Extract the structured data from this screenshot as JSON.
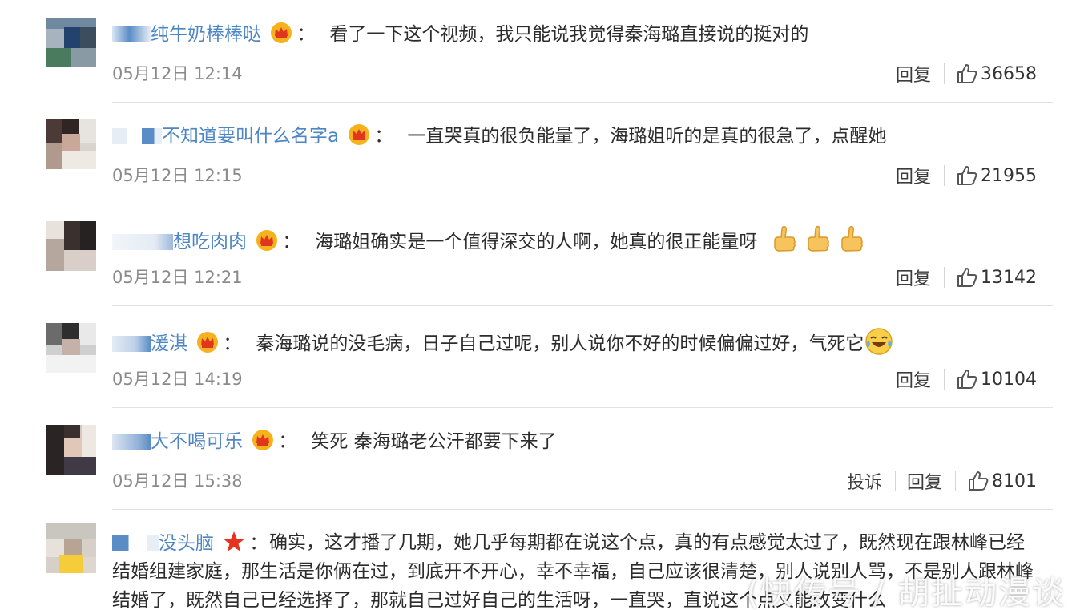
{
  "colors": {
    "username": "#4e86c4",
    "text": "#2c2c2c",
    "meta": "#8a8a8a",
    "divider": "#e2e2e2"
  },
  "comments": [
    {
      "username": "纯牛奶棒棒哒",
      "badge": "crown-icon",
      "text": "看了一下这个视频，我只能说我觉得秦海璐直接说的挺对的",
      "time": "05月12日 12:14",
      "reply": "回复",
      "likes": "36658"
    },
    {
      "username": "不知道要叫什么名字a",
      "badge": "crown-icon",
      "text": "一直哭真的很负能量了，海璐姐听的是真的很急了，点醒她",
      "time": "05月12日 12:15",
      "reply": "回复",
      "likes": "21955"
    },
    {
      "username": "想吃肉肉",
      "badge": "crown-icon",
      "text": "海璐姐确实是一个值得深交的人啊，她真的很正能量呀",
      "emoji": "thumbs-up-icon",
      "time": "05月12日 12:21",
      "reply": "回复",
      "likes": "13142"
    },
    {
      "username": "湲淇",
      "badge": "crown-icon",
      "text": "秦海璐说的没毛病，日子自己过呢，别人说你不好的时候偏偏过好，气死它",
      "emoji": "laugh-cry-icon",
      "time": "05月12日 14:19",
      "reply": "回复",
      "likes": "10104"
    },
    {
      "username": "大不喝可乐",
      "badge": "crown-icon",
      "text": "笑死 秦海璐老公汗都要下来了",
      "time": "05月12日 15:38",
      "report": "投诉",
      "reply": "回复",
      "likes": "8101"
    },
    {
      "username": "没头脑",
      "badge": "star-icon",
      "text": "确实，这才播了几期，她几乎每期都在说这个点，真的有点感觉太过了，既然现在跟林峰已经结婚组建家庭，那生活是你俩在过，到底开不开心，幸不幸福，自己应该很清楚，别人说别人骂，不是别人跟林峰结婚了，既然自己已经选择了，那就自己过好自己的生活呀，一直哭，直说这个点又能改变什么"
    }
  ],
  "watermark": "(快传号 / 胡扯动漫谈"
}
